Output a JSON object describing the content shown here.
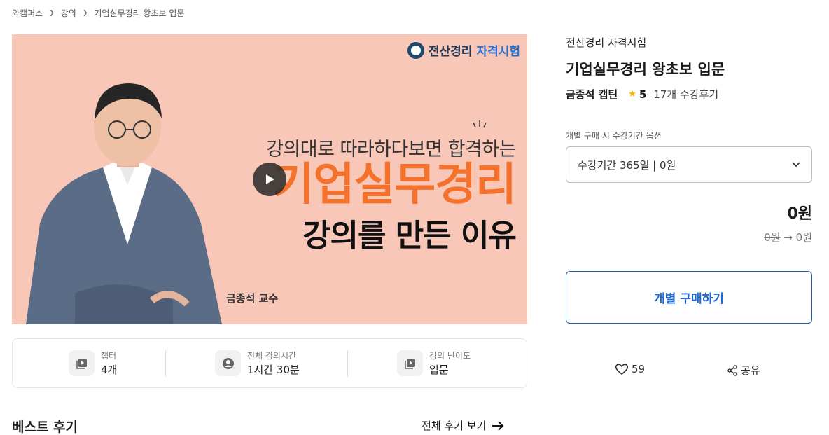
{
  "breadcrumb": {
    "items": [
      "와캠퍼스",
      "강의",
      "기업실무경리 왕초보 입문"
    ]
  },
  "video": {
    "badge_part1": "전산경리",
    "badge_part2": "자격시험",
    "headline_top": "강의대로 따라하다보면 합격하는",
    "headline_main": "기업실무경리",
    "headline_bottom": "강의를 만든 이유",
    "professor": "금종석 교수"
  },
  "stats": [
    {
      "label": "챕터",
      "value": "4개",
      "icon": "play-list-icon"
    },
    {
      "label": "전체 강의시간",
      "value": "1시간 30분",
      "icon": "person-icon"
    },
    {
      "label": "강의 난이도",
      "value": "입문",
      "icon": "play-list-icon"
    }
  ],
  "reviews_section": {
    "title": "베스트 후기",
    "view_all": "전체 후기 보기"
  },
  "course": {
    "category": "전산경리 자격시험",
    "title": "기업실무경리 왕초보 입문",
    "instructor": "금종석 캡틴",
    "rating": "5",
    "review_count_text": "17개 수강후기"
  },
  "purchase": {
    "option_label": "개별 구매 시 수강기간 옵션",
    "selected_option": "수강기간 365일 | 0원",
    "price": "0원",
    "original_price": "0원",
    "arrow": "→",
    "final_price": "0원",
    "buy_label": "개별 구매하기"
  },
  "actions": {
    "likes": "59",
    "share_label": "공유"
  },
  "colors": {
    "accent": "#1c6ad6",
    "thumbnail_bg": "#f9c7b7",
    "headline_orange": "#f4722b",
    "star": "#f5b400"
  }
}
